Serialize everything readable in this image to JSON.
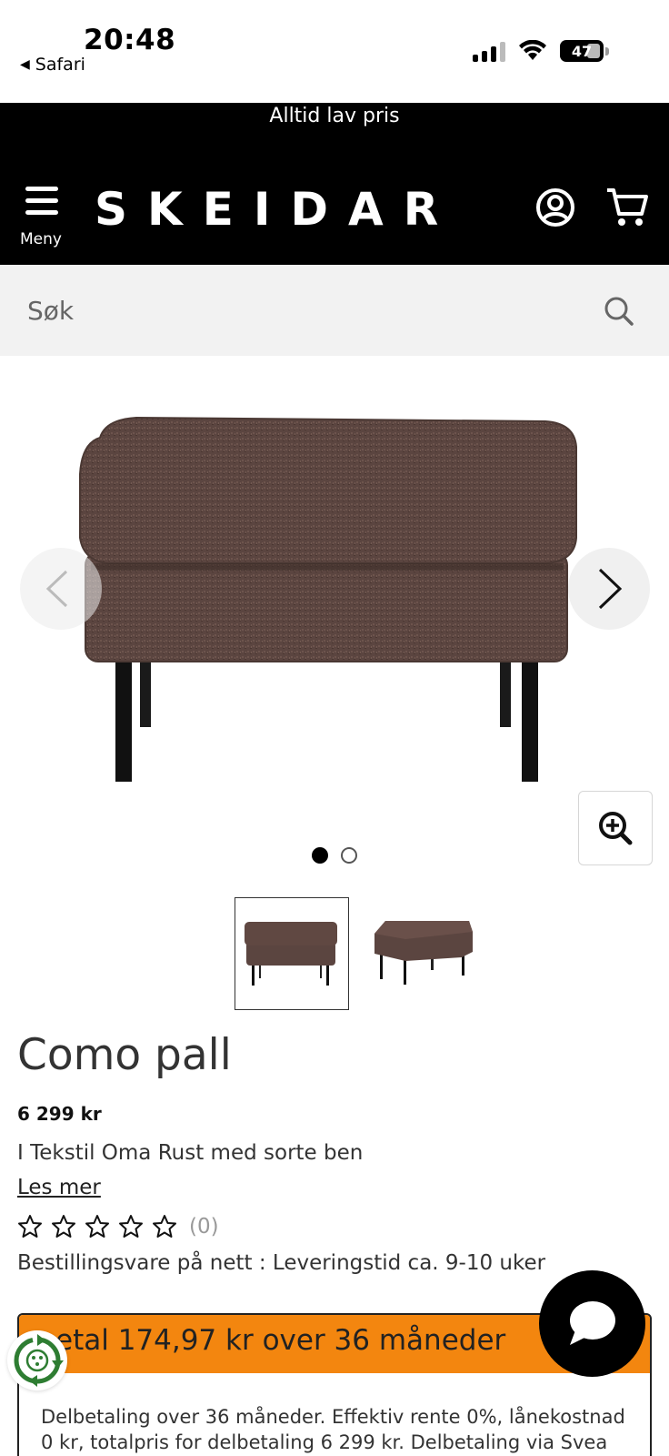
{
  "status_bar": {
    "time": "20:48",
    "back_app": "Safari",
    "battery": "47"
  },
  "header": {
    "tagline": "Alltid lav pris",
    "logo": "SKEIDAR",
    "menu_label": "Meny"
  },
  "search": {
    "placeholder": "Søk"
  },
  "gallery": {
    "dots_total": 2,
    "active_dot": 1
  },
  "product": {
    "title": "Como pall",
    "price": "6 299 kr",
    "variant": "I Tekstil Oma Rust med sorte ben",
    "read_more": "Les mer",
    "rating_stars": 0,
    "rating_count": "(0)",
    "delivery": "Bestillingsvare på nett : Leveringstid ca. 9-10 uker"
  },
  "finance": {
    "headline": "etal 174,97 kr over 36 måneder",
    "body": "Delbetaling over 36 måneder. Effektiv rente 0%, lånekostnad 0 kr, totalpris for delbetaling 6 299 kr. Delbetaling via Svea"
  },
  "colors": {
    "header_bg": "#000000",
    "search_bg": "#f2f2f2",
    "finance_accent": "#f3860f",
    "fabric": "#5b4540"
  }
}
